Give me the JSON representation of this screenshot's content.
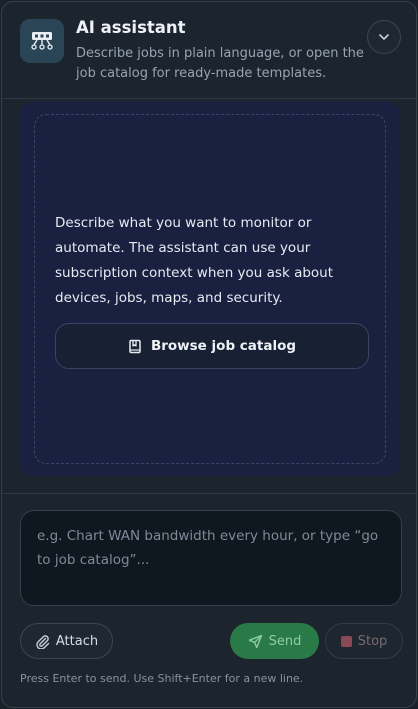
{
  "header": {
    "title": "AI assistant",
    "subtitle": "Describe jobs in plain language, or open the job catalog for ready-made templates."
  },
  "body": {
    "intro": "Describe what you want to monitor or automate. The assistant can use your subscription context when you ask about devices, jobs, maps, and security.",
    "catalog_button_label": "Browse job catalog"
  },
  "composer": {
    "placeholder": "e.g. Chart WAN bandwidth every hour, or type “go to job catalog”...",
    "value": ""
  },
  "actions": {
    "attach_label": "Attach",
    "send_label": "Send",
    "stop_label": "Stop"
  },
  "hint": "Press Enter to send. Use Shift+Enter for a new line.",
  "icons": {
    "logo": "robot-icon",
    "collapse": "chevron-down-icon",
    "catalog": "book-icon",
    "attach": "paperclip-icon",
    "send": "send-icon",
    "stop": "stop-icon"
  },
  "colors": {
    "send_accent": "#2a7a47",
    "stop_accent": "#8a4a55"
  }
}
